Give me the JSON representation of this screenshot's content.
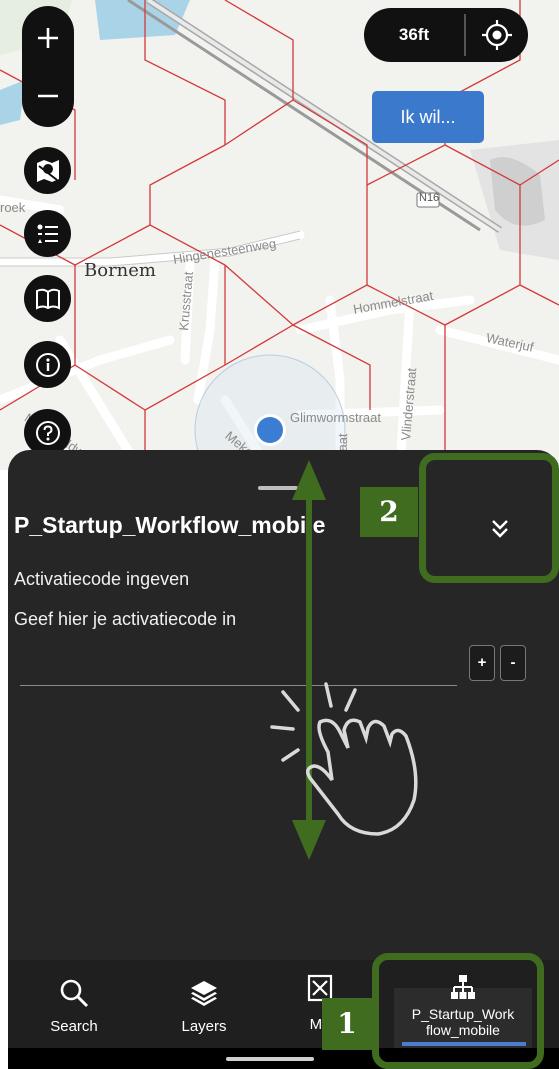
{
  "map": {
    "scale_label": "36ft",
    "action_button": "Ik wil...",
    "labels": {
      "town": "Bornem",
      "hingene": "Hingenesteenweg",
      "kruis": "Krusstraat",
      "hommel": "Hommelstraat",
      "glimworm": "Glimwormstraat",
      "vlinder": "Vlinderstraat",
      "road_badge": "N16",
      "water": "Waterjuf",
      "molen": "Molenveldweg",
      "roek": "roek",
      "meke": "Mekeverst",
      "rstraat": "rstraat"
    },
    "tool_icons": [
      "plus-icon",
      "minus-icon",
      "map-pin-icon",
      "legend-list-icon",
      "book-icon",
      "info-icon",
      "help-icon",
      "locate-icon"
    ]
  },
  "panel": {
    "title": "P_Startup_Workflow_mobile",
    "heading": "Activatiecode ingeven",
    "prompt": "Geef hier je activatiecode in",
    "plus_label": "+",
    "minus_label": "-"
  },
  "nav": {
    "items": [
      {
        "label": "Search",
        "icon": "search-icon"
      },
      {
        "label": "Layers",
        "icon": "layers-icon"
      },
      {
        "label": "Map",
        "visible_label": "Ma",
        "icon": "map-icon"
      },
      {
        "label": "P_Startup_Work flow_mobile",
        "line1": "P_Startup_Work",
        "line2": "flow_mobile",
        "icon": "workflow-icon"
      }
    ]
  },
  "annotations": {
    "badge1": "1",
    "badge2": "2",
    "accent": "#3f6c1f"
  },
  "colors": {
    "accent_blue": "#3a79cc",
    "panel_bg": "#262626",
    "grid_red": "#d23a3a",
    "location_dot": "#3a7dd3"
  }
}
